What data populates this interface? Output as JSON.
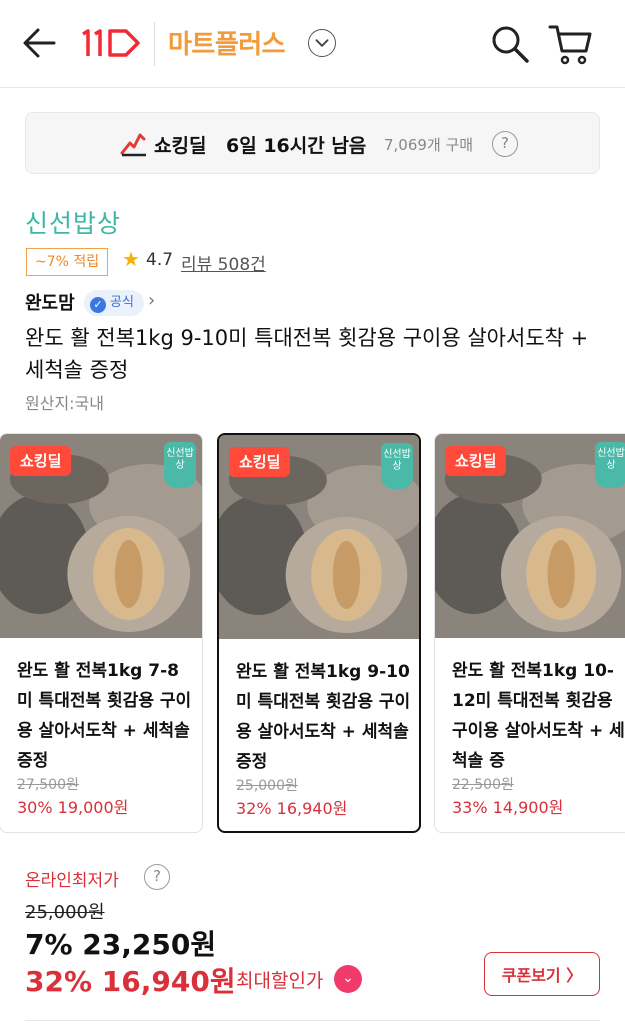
{
  "header": {
    "logo_text": "11",
    "brand": "마트플러스"
  },
  "deal_banner": {
    "label": "쇼킹딜",
    "time_left": "6일 16시간 남음",
    "purchase_count": "7,069개 구매",
    "help": "?"
  },
  "product": {
    "store_logo": "신선밥상",
    "reward_badge": "~7% 적립",
    "rating": "4.7",
    "reviews": "리뷰 508건",
    "seller": "완도맘",
    "official_badge": "공식",
    "title": "완도 활 전복1kg 9-10미 특대전복 횟감용 구이용 살아서도착 + 세척솔 증정",
    "origin": "원산지:국내"
  },
  "options": [
    {
      "tag": "쇼킹딜",
      "fresh_tag": "신선밥상",
      "title": "완도 활 전복1kg 7-8미 특대전복 횟감용 구이용 살아서도착 + 세척솔 증정",
      "original_price": "27,500원",
      "discount_price": "30% 19,000원",
      "selected": false
    },
    {
      "tag": "쇼킹딜",
      "fresh_tag": "신선밥상",
      "title": "완도 활 전복1kg 9-10미 특대전복 횟감용 구이용 살아서도착 + 세척솔 증정",
      "original_price": "25,000원",
      "discount_price": "32% 16,940원",
      "selected": true
    },
    {
      "tag": "쇼킹딜",
      "fresh_tag": "신선밥상",
      "title": "완도 활 전복1kg 10-12미 특대전복 횟감용 구이용 살아서도착 + 세척솔 증",
      "original_price": "22,500원",
      "discount_price": "33% 14,900원",
      "selected": false
    }
  ],
  "pricing": {
    "lowest_label": "온라인최저가",
    "original_price": "25,000원",
    "mid_price": "7% 23,250원",
    "final_price": "32% 16,940원",
    "max_discount_label": "최대할인가",
    "coupon_button": "쿠폰보기 〉"
  },
  "colors": {
    "accent_red": "#d9303a",
    "brand_orange": "#f39a3b",
    "fresh_green": "#3fb7a6"
  },
  "icons": [
    "back-arrow-icon",
    "search-icon",
    "cart-icon",
    "chevron-down-icon",
    "deal-icon",
    "help-icon",
    "star-icon",
    "verified-icon",
    "chevron-right-icon"
  ]
}
